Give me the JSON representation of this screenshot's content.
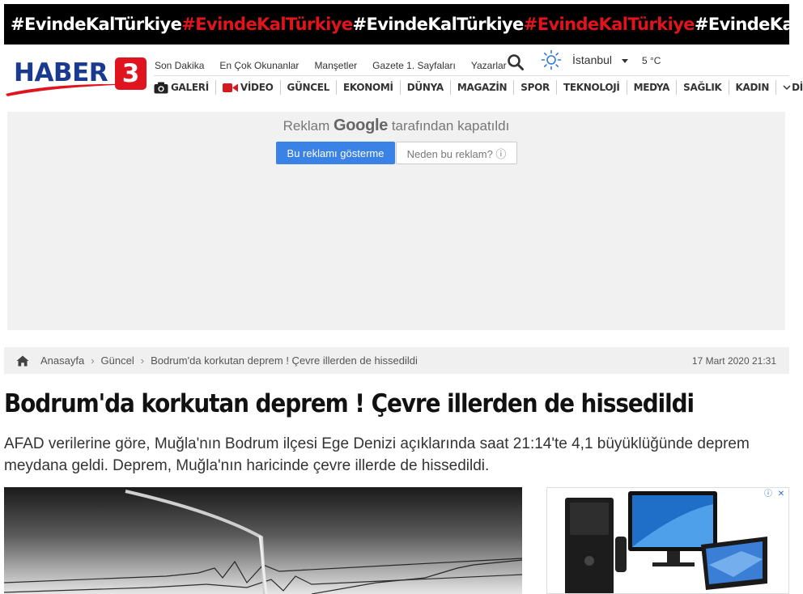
{
  "banner": {
    "tags": [
      {
        "text": "#EvindeKalTürkiye",
        "color": "#ffffff"
      },
      {
        "text": "#EvindeKalTürkiye",
        "color": "#e3131c"
      },
      {
        "text": "#EvindeKalTürkiye",
        "color": "#ffffff"
      },
      {
        "text": "#EvindeKalTürkiye",
        "color": "#e3131c"
      },
      {
        "text": "#EvindeKalTürkiye",
        "color": "#ffffff"
      }
    ]
  },
  "logo": {
    "text": "HABER",
    "number": "3",
    "brand_color": "#1a3a8f",
    "accent_color": "#e0141e"
  },
  "topnav": [
    "Son Dakika",
    "En Çok Okunanlar",
    "Manşetler",
    "Gazete 1. Sayfaları",
    "Yazarlar"
  ],
  "weather": {
    "city": "İstanbul",
    "temp": "5 °C",
    "icon": "sun-icon"
  },
  "mainnav": [
    {
      "label": "GALERİ",
      "icon": "camera-icon"
    },
    {
      "label": "VİDEO",
      "icon": "video-icon"
    },
    {
      "label": "GÜNCEL"
    },
    {
      "label": "EKONOMİ"
    },
    {
      "label": "DÜNYA"
    },
    {
      "label": "MAGAZİN"
    },
    {
      "label": "SPOR"
    },
    {
      "label": "TEKNOLOJİ"
    },
    {
      "label": "MEDYA"
    },
    {
      "label": "SAĞLIK"
    },
    {
      "label": "KADIN"
    },
    {
      "label": "DİĞER",
      "icon": "chevron-down-icon"
    }
  ],
  "ad": {
    "closed_prefix": "Reklam",
    "closed_brand": "Google",
    "closed_suffix": "tarafından kapatıldı",
    "show_button": "Bu reklamı gösterme",
    "why_button": "Neden bu reklam? ⓘ"
  },
  "breadcrumb": {
    "home": "Anasayfa",
    "category": "Güncel",
    "current": "Bodrum'da korkutan deprem ! Çevre illerden de hissedildi",
    "date": "17 Mart 2020 21:31"
  },
  "article": {
    "title": "Bodrum'da korkutan deprem ! Çevre illerden de hissedildi",
    "summary": "AFAD verilerine göre, Muğla'nın Bodrum ilçesi Ege Denizi açıklarında saat 21:14'te 4,1 büyüklüğünde deprem meydana geldi. Deprem, Muğla'nın haricinde çevre illerde de hissedildi."
  }
}
